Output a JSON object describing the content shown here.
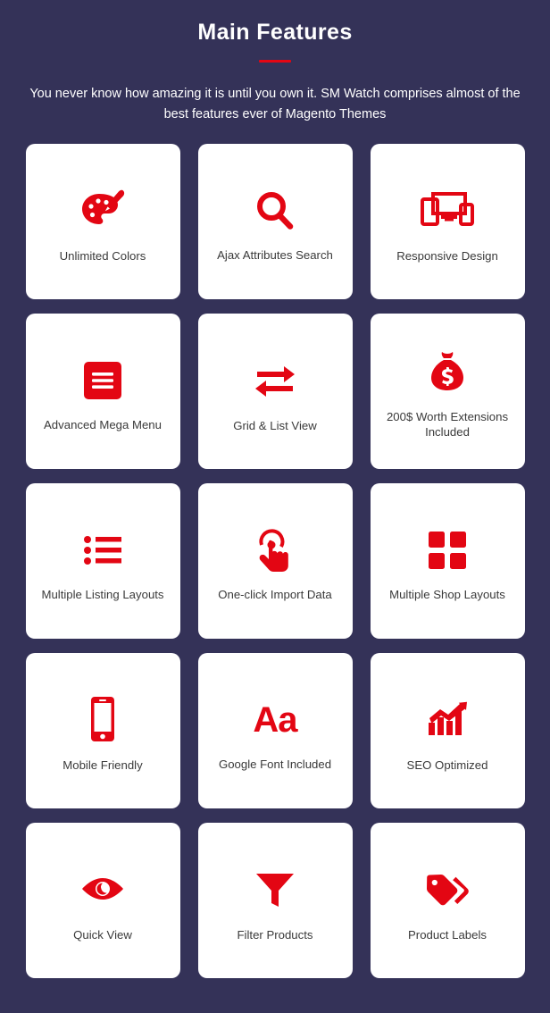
{
  "theme": {
    "background": "#343258",
    "card_background": "#ffffff",
    "accent_red": "#e30613",
    "title_color": "#ffffff",
    "label_color": "#3a3a3a"
  },
  "header": {
    "title": "Main Features",
    "subtitle": "You never know how amazing it is until you own it. SM Watch comprises almost of the best features ever of Magento Themes"
  },
  "features": [
    {
      "label": "Unlimited Colors",
      "icon": "palette-icon"
    },
    {
      "label": "Ajax Attributes Search",
      "icon": "search-icon"
    },
    {
      "label": "Responsive Design",
      "icon": "responsive-devices-icon"
    },
    {
      "label": "Advanced Mega Menu",
      "icon": "hamburger-menu-icon"
    },
    {
      "label": "Grid & List View",
      "icon": "exchange-arrows-icon"
    },
    {
      "label": "200$ Worth Extensions Included",
      "icon": "money-bag-icon"
    },
    {
      "label": "Multiple Listing Layouts",
      "icon": "bullet-list-icon"
    },
    {
      "label": "One-click Import Data",
      "icon": "tap-hand-icon"
    },
    {
      "label": "Multiple Shop Layouts",
      "icon": "grid-squares-icon"
    },
    {
      "label": "Mobile Friendly",
      "icon": "mobile-phone-icon"
    },
    {
      "label": "Google Font Included",
      "icon": "aa-typography-icon"
    },
    {
      "label": "SEO Optimized",
      "icon": "growth-chart-icon"
    },
    {
      "label": "Quick View",
      "icon": "eye-icon"
    },
    {
      "label": "Filter Products",
      "icon": "funnel-icon"
    },
    {
      "label": "Product Labels",
      "icon": "price-tags-icon"
    }
  ]
}
